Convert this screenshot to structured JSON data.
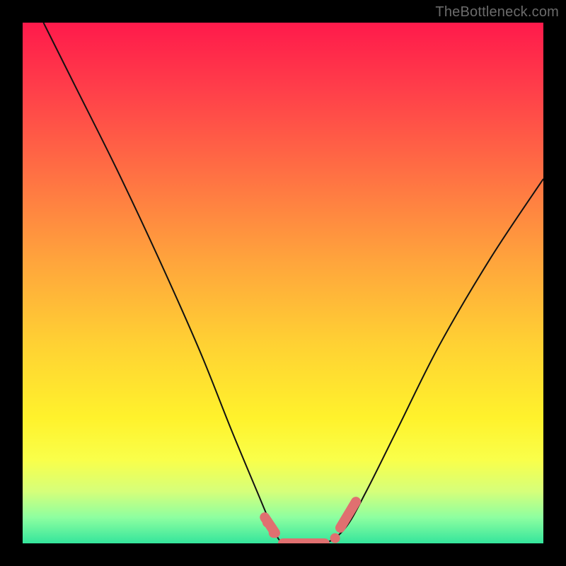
{
  "watermark": "TheBottleneck.com",
  "chart_data": {
    "type": "line",
    "title": "",
    "xlabel": "",
    "ylabel": "",
    "xlim": [
      0,
      100
    ],
    "ylim": [
      0,
      100
    ],
    "series": [
      {
        "name": "curve",
        "x": [
          4,
          10,
          18,
          26,
          34,
          40,
          45,
          48,
          50,
          53,
          58,
          62,
          66,
          72,
          80,
          90,
          100
        ],
        "y": [
          100,
          88,
          72,
          55,
          37,
          22,
          10,
          3,
          0,
          0,
          0,
          3,
          10,
          22,
          38,
          55,
          70
        ]
      }
    ],
    "highlight_segments": [
      {
        "x": [
          46.5,
          48.5
        ],
        "y": [
          5,
          2
        ]
      },
      {
        "x": [
          50,
          58
        ],
        "y": [
          0,
          0
        ]
      },
      {
        "x": [
          61,
          64
        ],
        "y": [
          3,
          8
        ]
      }
    ],
    "highlight_points": [
      {
        "x": 47,
        "y": 4
      },
      {
        "x": 48.2,
        "y": 2
      },
      {
        "x": 60,
        "y": 1
      }
    ],
    "gradient_stops": [
      {
        "pos": 0.0,
        "color": "#ff1a4b"
      },
      {
        "pos": 0.28,
        "color": "#ff6d44"
      },
      {
        "pos": 0.62,
        "color": "#ffd233"
      },
      {
        "pos": 0.84,
        "color": "#f9ff4a"
      },
      {
        "pos": 1.0,
        "color": "#34e59c"
      }
    ]
  }
}
